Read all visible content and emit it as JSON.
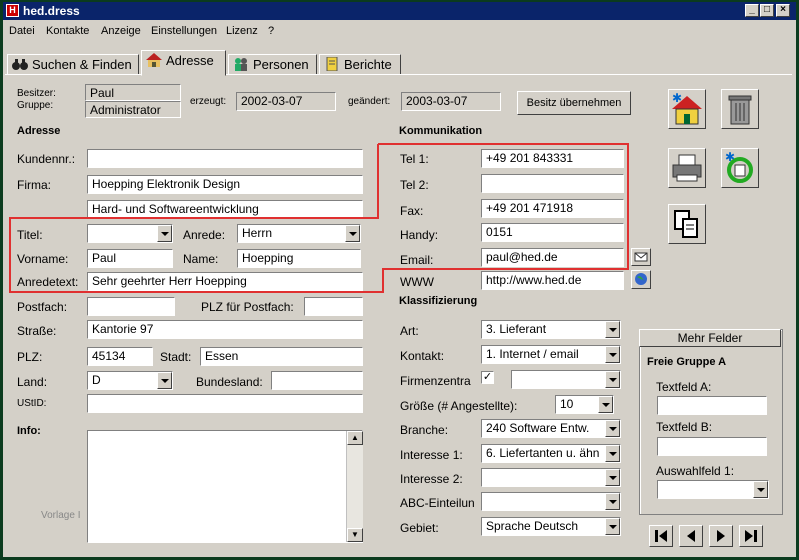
{
  "window": {
    "title": "hed.dress",
    "app_icon_text": "H"
  },
  "menu": [
    "Datei",
    "Kontakte",
    "Anzeige",
    "Einstellungen",
    "Lizenz",
    "?"
  ],
  "tabs": [
    {
      "label": "Suchen & Finden",
      "icon": "binoculars-icon"
    },
    {
      "label": "Adresse",
      "icon": "house-icon",
      "active": true
    },
    {
      "label": "Personen",
      "icon": "people-icon"
    },
    {
      "label": "Berichte",
      "icon": "notebook-icon"
    }
  ],
  "meta": {
    "besitzer_label": "Besitzer:",
    "besitzer": "Paul",
    "gruppe_label": "Gruppe:",
    "gruppe": "Administrator",
    "erzeugt_label": "erzeugt:",
    "erzeugt": "2002-03-07",
    "geaendert_label": "geändert:",
    "geaendert": "2003-03-07",
    "besitz_button": "Besitz übernehmen"
  },
  "adresse": {
    "header": "Adresse",
    "kundennr_label": "Kundennr.:",
    "kundennr": "",
    "firma_label": "Firma:",
    "firma1": "Hoepping Elektronik Design",
    "firma2": "Hard- und Softwareentwicklung",
    "titel_label": "Titel:",
    "titel": "",
    "anrede_label": "Anrede:",
    "anrede": "Herrn",
    "vorname_label": "Vorname:",
    "vorname": "Paul",
    "name_label": "Name:",
    "name": "Hoepping",
    "anredetext_label": "Anredetext:",
    "anredetext": "Sehr geehrter Herr Hoepping",
    "postfach_label": "Postfach:",
    "postfach": "",
    "plz_postfach_label": "PLZ für Postfach:",
    "plz_postfach": "",
    "strasse_label": "Straße:",
    "strasse": "Kantorie 97",
    "plz_label": "PLZ:",
    "plz": "45134",
    "stadt_label": "Stadt:",
    "stadt": "Essen",
    "land_label": "Land:",
    "land": "D",
    "bundesland_label": "Bundesland:",
    "bundesland": "",
    "ustid_label": "UStID:",
    "ustid": "",
    "info_label": "Info:",
    "info": ""
  },
  "kommunikation": {
    "header": "Kommunikation",
    "tel1_label": "Tel 1:",
    "tel1": "+49 201 843331",
    "tel2_label": "Tel 2:",
    "tel2": "",
    "fax_label": "Fax:",
    "fax": "+49 201 471918",
    "handy_label": "Handy:",
    "handy": "0151",
    "email_label": "Email:",
    "email": "paul@hed.de",
    "www_label": "WWW",
    "www": "http://www.hed.de"
  },
  "klassifizierung": {
    "header": "Klassifizierung",
    "art_label": "Art:",
    "art": "3. Lieferant",
    "kontakt_label": "Kontakt:",
    "kontakt": "1. Internet / email",
    "firmenzentrale_label": "Firmenzentra",
    "firmenzentrale_checked": true,
    "firmenzentrale_value": "",
    "groesse_label": "Größe (# Angestellte):",
    "groesse": "10",
    "branche_label": "Branche:",
    "branche": "240 Software Entw.",
    "interesse1_label": "Interesse 1:",
    "interesse1": "6. Liefertanten u. ähn",
    "interesse2_label": "Interesse 2:",
    "interesse2": "",
    "abc_label": "ABC-Einteilun",
    "abc": "",
    "gebiet_label": "Gebiet:",
    "gebiet": "Sprache Deutsch"
  },
  "mehr_felder": {
    "button": "Mehr Felder",
    "group_title": "Freie Gruppe A",
    "textfeld_a_label": "Textfeld A:",
    "textfeld_a": "",
    "textfeld_b_label": "Textfeld B:",
    "textfeld_b": "",
    "auswahlfeld_label": "Auswahlfeld 1:",
    "auswahlfeld": ""
  },
  "watermark": "Vorlage I",
  "colors": {
    "highlight_box": "#e03030",
    "titlebar": "#0a246a",
    "face": "#d4d0c8"
  }
}
